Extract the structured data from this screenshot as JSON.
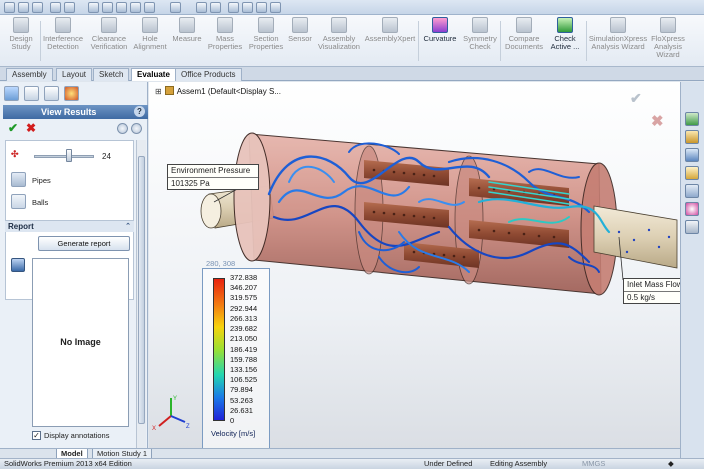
{
  "ribbon": {
    "buttons": [
      {
        "label": "Design Study",
        "active": false
      },
      {
        "label": "Interference Detection",
        "active": false
      },
      {
        "label": "Clearance Verification",
        "active": false
      },
      {
        "label": "Hole Alignment",
        "active": false
      },
      {
        "label": "Measure",
        "active": false
      },
      {
        "label": "Mass Properties",
        "active": false
      },
      {
        "label": "Section Properties",
        "active": false
      },
      {
        "label": "Sensor",
        "active": false
      },
      {
        "label": "Assembly Visualization",
        "active": false
      },
      {
        "label": "AssemblyXpert",
        "active": false
      },
      {
        "label": "Curvature",
        "active": true
      },
      {
        "label": "Symmetry Check",
        "active": false
      },
      {
        "label": "Compare Documents",
        "active": false
      },
      {
        "label": "Check Active ...",
        "active": true
      },
      {
        "label": "SimulationXpress Analysis Wizard",
        "active": false
      },
      {
        "label": "FloXpress Analysis Wizard",
        "active": false
      }
    ]
  },
  "command_tabs": [
    "Assembly",
    "Layout",
    "Sketch",
    "Evaluate",
    "Office Products"
  ],
  "active_command_tab": "Evaluate",
  "panel": {
    "title": "View Results",
    "help": "?",
    "slider_value": "24",
    "options": [
      "Pipes",
      "Balls"
    ],
    "report_header": "Report",
    "generate_button": "Generate report",
    "no_image": "No Image",
    "display_annotations": "Display annotations",
    "display_annotations_checked": true
  },
  "viewport": {
    "tree_item": "Assem1 (Default<Display S...",
    "env_callout": {
      "label": "Environment Pressure",
      "value": "101325 Pa"
    },
    "inlet_callout": {
      "label": "Inlet Mass Flow",
      "value": "0.5 kg/s"
    },
    "legend": {
      "title": "280, 308",
      "ticks": [
        "372.838",
        "346.207",
        "319.575",
        "292.944",
        "266.313",
        "239.682",
        "213.050",
        "186.419",
        "159.788",
        "133.156",
        "106.525",
        "79.894",
        "53.263",
        "26.631",
        "0"
      ],
      "unit": "Velocity [m/s]"
    },
    "watermark": "www.3dmoz.com"
  },
  "bottom_tabs": [
    "Model",
    "Motion Study 1"
  ],
  "active_bottom_tab": "Model",
  "status": {
    "product": "SolidWorks Premium 2013 x64 Edition",
    "definition": "Under Defined",
    "mode": "Editing Assembly",
    "units": "MMGS"
  }
}
